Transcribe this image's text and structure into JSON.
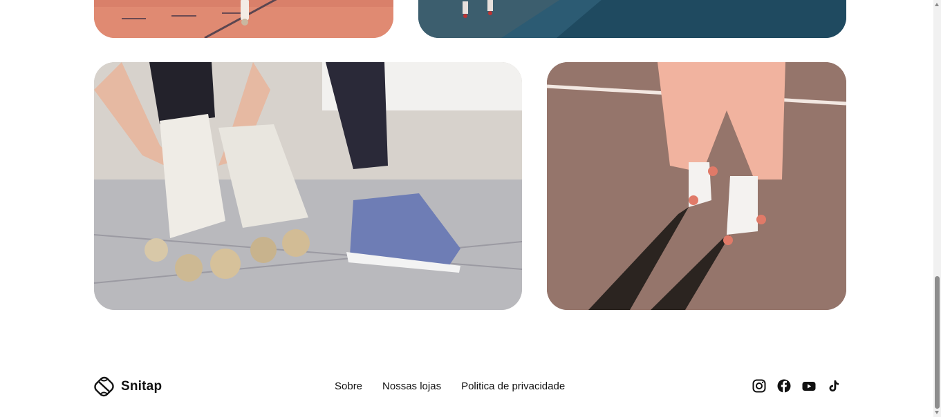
{
  "gallery": {
    "photos": [
      {
        "alt": "skater legs on orange court"
      },
      {
        "alt": "skater on blue asphalt"
      },
      {
        "alt": "hands lacing white roller skates"
      },
      {
        "alt": "skater in pink pants on court"
      }
    ]
  },
  "footer": {
    "brand": "Snitap",
    "links": [
      "Sobre",
      "Nossas lojas",
      "Politica de privacidade"
    ],
    "social_icons": [
      "instagram-icon",
      "facebook-icon",
      "youtube-icon",
      "tiktok-icon"
    ]
  },
  "colors": {
    "text": "#111111",
    "background": "#ffffff"
  }
}
